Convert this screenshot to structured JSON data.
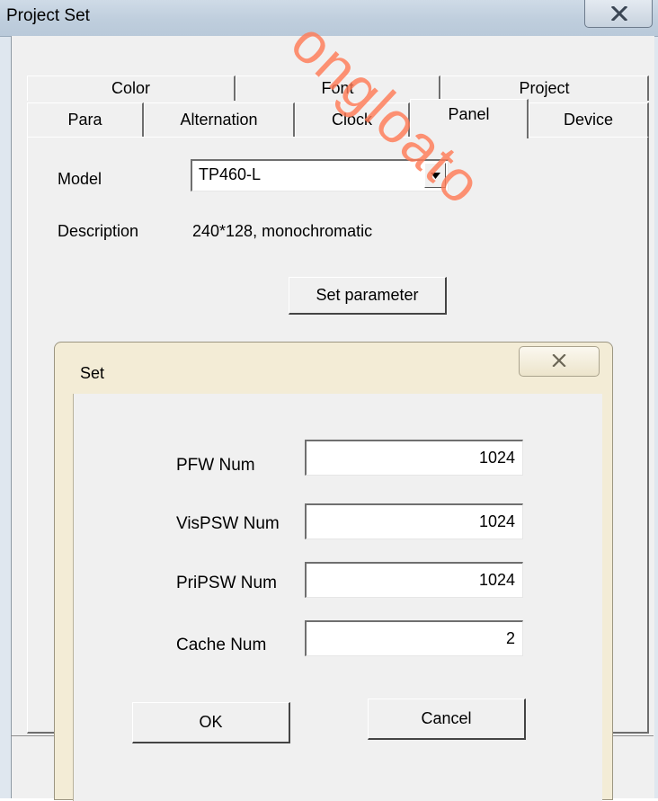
{
  "window": {
    "title": "Project Set",
    "close_icon": "close-x"
  },
  "tabs": {
    "row1": [
      "Color",
      "Font",
      "Project"
    ],
    "row2": [
      "Para",
      "Alternation",
      "Clock",
      "Panel",
      "Device"
    ],
    "active": "Panel"
  },
  "panel": {
    "model_label": "Model",
    "model_value": "TP460-L",
    "description_label": "Description",
    "description_value": "240*128, monochromatic",
    "set_parameter_label": "Set parameter"
  },
  "dialog": {
    "title": "Set",
    "fields": [
      {
        "label": "PFW Num",
        "value": "1024"
      },
      {
        "label": "VisPSW Num",
        "value": "1024"
      },
      {
        "label": "PriPSW Num",
        "value": "1024"
      },
      {
        "label": "Cache Num",
        "value": "2"
      }
    ],
    "ok_label": "OK",
    "cancel_label": "Cancel"
  },
  "watermark": {
    "text": "ongloato"
  },
  "colors": {
    "dialog_frame": "#f3ecd6",
    "window_frame": "#dfe7ef",
    "watermark": "#ff7b57"
  }
}
